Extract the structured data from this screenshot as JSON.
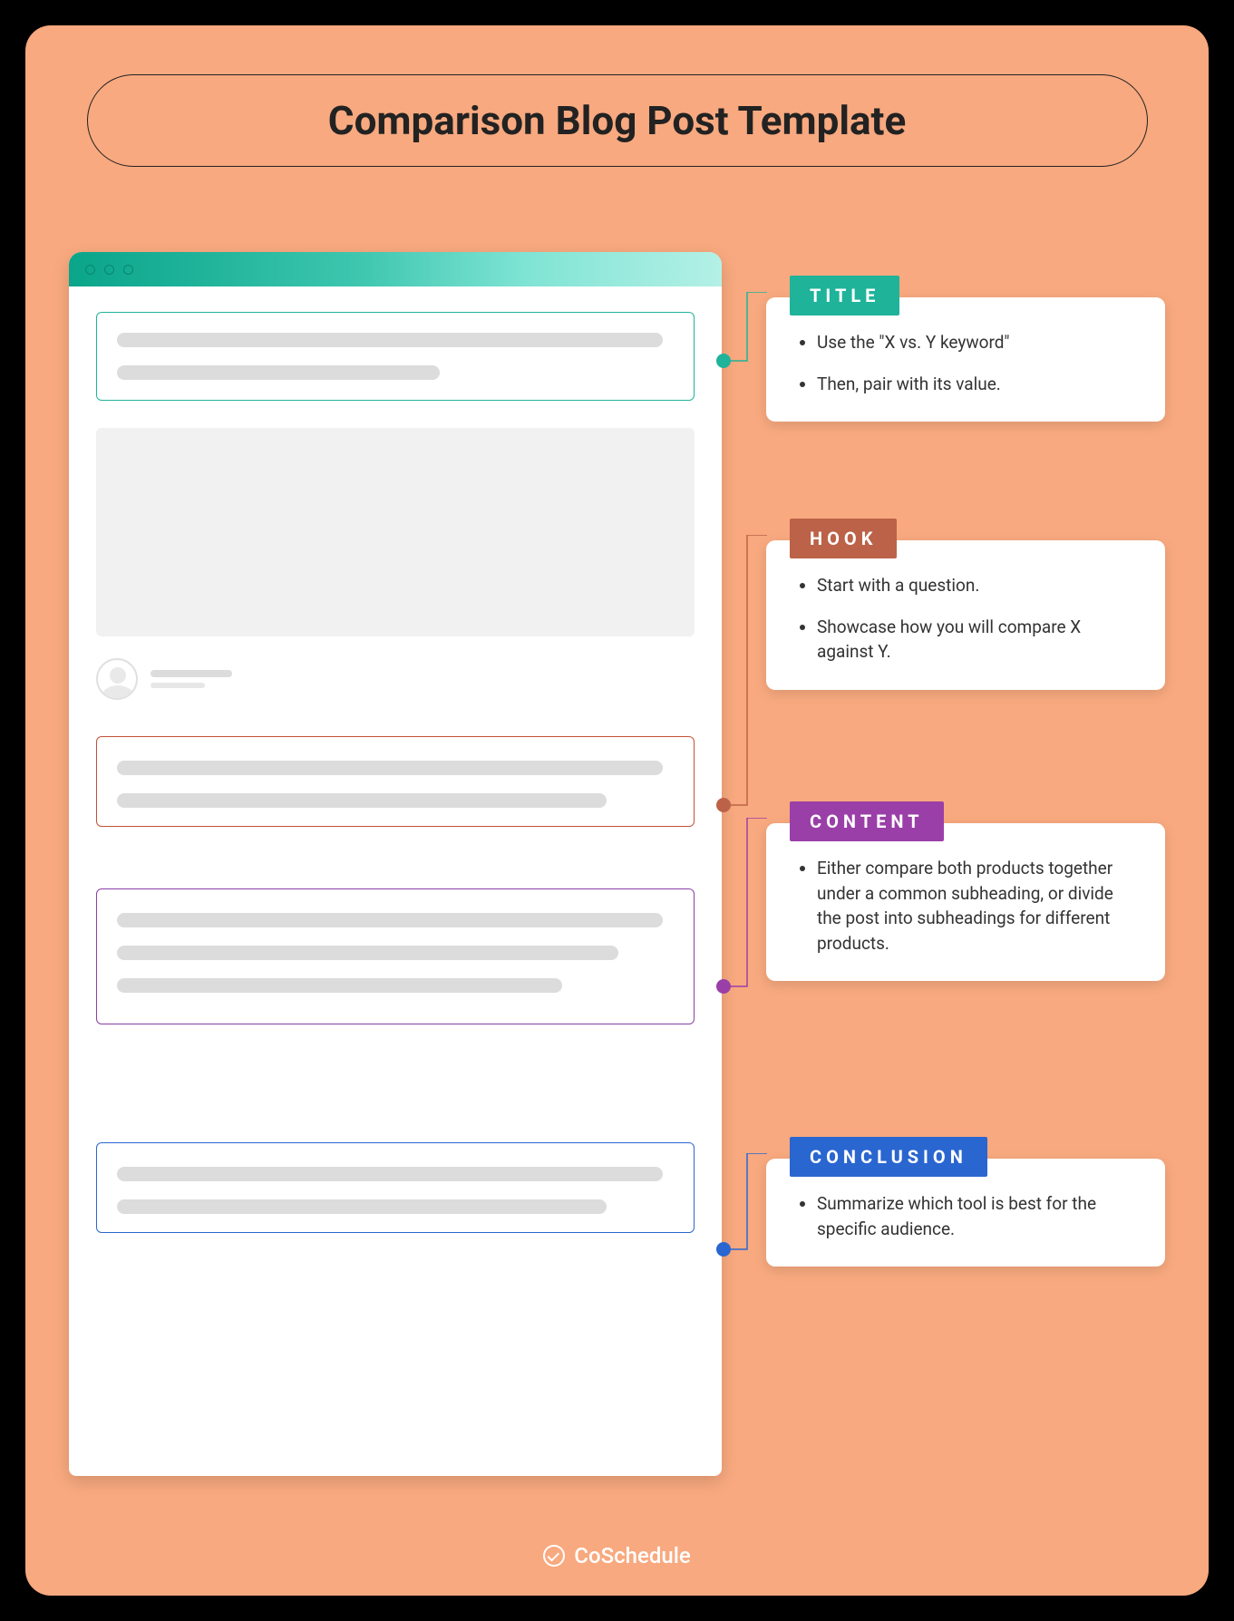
{
  "page_title": "Comparison Blog Post Template",
  "sections": {
    "title": {
      "label": "TITLE",
      "color": "#1fb39a",
      "bullets": [
        "Use the \"X vs. Y keyword\"",
        "Then, pair with its value."
      ]
    },
    "hook": {
      "label": "HOOK",
      "color": "#bc6248",
      "bullets": [
        "Start with a question.",
        "Showcase how you will compare X against Y."
      ]
    },
    "content": {
      "label": "CONTENT",
      "color": "#9a3fa8",
      "bullets": [
        "Either compare both products together under a common subheading, or divide the post into subheadings for different products."
      ]
    },
    "conclusion": {
      "label": "CONCLUSION",
      "color": "#2a66d0",
      "bullets": [
        "Summarize which tool is best for the specific audience."
      ]
    }
  },
  "footer_brand": "CoSchedule"
}
